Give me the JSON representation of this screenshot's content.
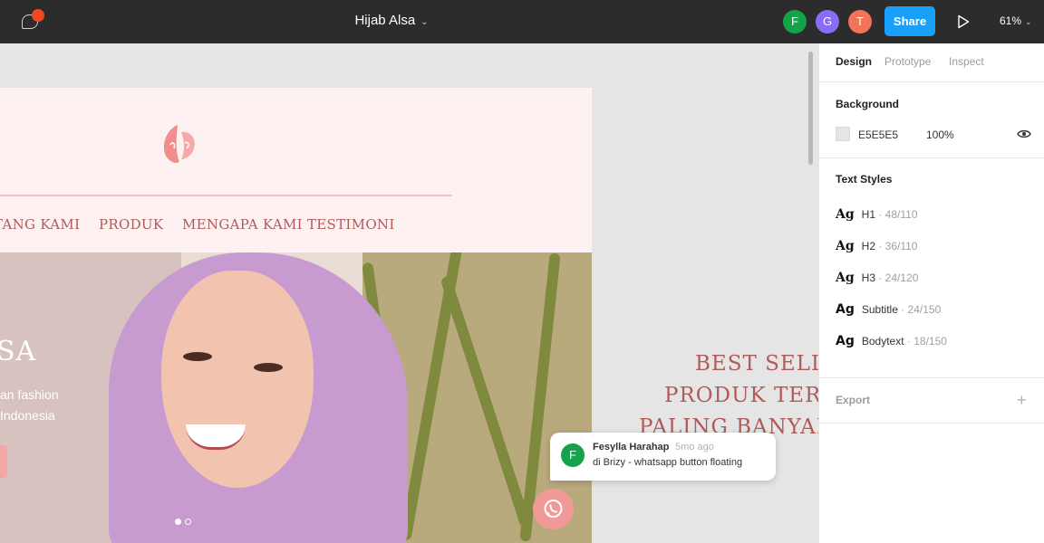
{
  "topbar": {
    "doc_title": "Hijab Alsa",
    "title_chevron": "⌄",
    "collaborators": [
      "F",
      "G",
      "T"
    ],
    "share_label": "Share",
    "zoom": "61%",
    "zoom_chevron": "⌄",
    "icons": {
      "comments": "comment-bubble-icon",
      "play": "play-icon"
    },
    "notification_color": "#f24822"
  },
  "canvas": {
    "background": "#E5E5E5",
    "nav_items": [
      "TANG KAMI",
      "PRODUK",
      "MENGAPA KAMI",
      "TESTIMONI"
    ],
    "hero": {
      "title": "SA",
      "subtitle_line1": "an fashion",
      "subtitle_line2": "Indonesia"
    },
    "best_seller_lines": [
      "BEST SELLE",
      "PRODUK TERL",
      "PALING BANYAK"
    ],
    "comment": {
      "avatar_letter": "F",
      "author": "Fesylla Harahap",
      "time": "5mo ago",
      "text": "di Brizy - whatsapp button floating"
    },
    "accent_pink": "#f19999",
    "nav_color": "#b05a5a"
  },
  "panel": {
    "tabs": [
      "Design",
      "Prototype",
      "Inspect"
    ],
    "active_tab": "Design",
    "background": {
      "title": "Background",
      "hex": "E5E5E5",
      "opacity": "100%"
    },
    "text_styles": {
      "title": "Text Styles",
      "ag": "Ag",
      "items": [
        {
          "name": "H1",
          "meta": " · 48/110"
        },
        {
          "name": "H2",
          "meta": " · 36/110"
        },
        {
          "name": "H3",
          "meta": " · 24/120"
        },
        {
          "name": "Subtitle",
          "meta": " · 24/150"
        },
        {
          "name": "Bodytext",
          "meta": " · 18/150"
        }
      ]
    },
    "export_title": "Export",
    "export_plus": "+"
  },
  "colors": {
    "share_blue": "#18a0fb",
    "avatar_f": "#14a34a",
    "avatar_g": "#8b6cf7",
    "avatar_t": "#f0735a"
  }
}
